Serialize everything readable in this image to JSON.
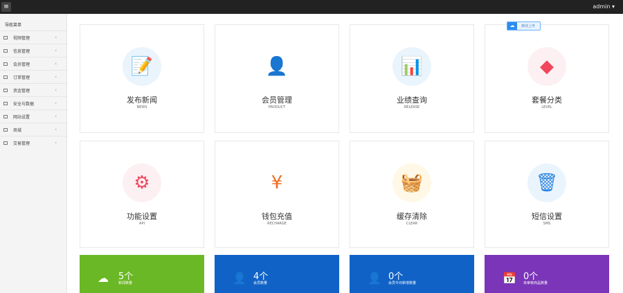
{
  "header": {
    "menu_icon": "hamburger-icon",
    "user": "admin ▾"
  },
  "sidebar": {
    "title": "导航菜单",
    "items": [
      {
        "label": "视频管理"
      },
      {
        "label": "信息管理"
      },
      {
        "label": "会员管理"
      },
      {
        "label": "订单管理"
      },
      {
        "label": "资金管理"
      },
      {
        "label": "安全与数据"
      },
      {
        "label": "网站设置"
      },
      {
        "label": "商城"
      },
      {
        "label": "交易管理"
      }
    ]
  },
  "badge": {
    "label": "离线上传"
  },
  "cards": [
    {
      "label": "发布新闻",
      "sub": "NEWS",
      "icon": "📝",
      "bg": "#eaf4fd",
      "color": "#2f86e0"
    },
    {
      "label": "会员管理",
      "sub": "PRODUCT",
      "icon": "👤",
      "bg": "#ffffff",
      "color": "#1fb552"
    },
    {
      "label": "业绩查询",
      "sub": "RELEASE",
      "icon": "📊",
      "bg": "#eaf4fd",
      "color": "#2f86e0"
    },
    {
      "label": "套餐分类",
      "sub": "LEVEL",
      "icon": "◆",
      "bg": "#fdf0f2",
      "color": "#f0475c"
    },
    {
      "label": "功能设置",
      "sub": "API",
      "icon": "⚙",
      "bg": "#fdf0f2",
      "color": "#f0475c"
    },
    {
      "label": "钱包充值",
      "sub": "RECHARGE",
      "icon": "¥",
      "bg": "#ffffff",
      "color": "#f06a1e"
    },
    {
      "label": "缓存清除",
      "sub": "CLEAR",
      "icon": "🧺",
      "bg": "#fff8e6",
      "color": "#f5b400"
    },
    {
      "label": "短信设置",
      "sub": "SMS",
      "icon": "🗑",
      "bg": "#eaf4fd",
      "color": "#2f86e0"
    }
  ],
  "stats": [
    {
      "value": "5个",
      "caption": "新闻数量",
      "icon": "☁",
      "color": "#6ab825"
    },
    {
      "value": "4个",
      "caption": "会员数量",
      "icon": "👤",
      "color": "#1062c6"
    },
    {
      "value": "0个",
      "caption": "会员今日新增数量",
      "icon": "👤",
      "color": "#1062c6"
    },
    {
      "value": "0个",
      "caption": "未审核商品数量",
      "icon": "📅",
      "color": "#7a35b8"
    }
  ]
}
